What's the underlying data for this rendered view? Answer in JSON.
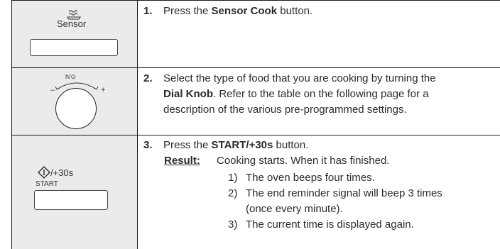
{
  "steps": [
    {
      "number": "1.",
      "text_before": "Press the ",
      "bold": "Sensor Cook",
      "text_after": " button.",
      "panel": {
        "label": "Sensor",
        "icon": "sensor-steam-icon"
      }
    },
    {
      "number": "2.",
      "line1": "Select the type of food that you are cooking by turning the",
      "bold": "Dial Knob",
      "line2_after": ". Refer to the table on the following page for a",
      "line3": "description of the various pre-programmed settings.",
      "panel": {
        "dial_top_label": "h/⊙",
        "minus": "–",
        "plus": "+",
        "icon": "dial-knob-icon"
      }
    },
    {
      "number": "3.",
      "text_before": "Press the ",
      "bold": "START/+30s",
      "text_after": " button.",
      "result_label": "Result:",
      "result_text": "Cooking starts. When it has finished.",
      "sub_items": [
        {
          "num": "1)",
          "lines": [
            "The oven beeps four times."
          ]
        },
        {
          "num": "2)",
          "lines": [
            "The end reminder signal will beep 3 times",
            "(once every minute)."
          ]
        },
        {
          "num": "3)",
          "lines": [
            "The current time is displayed again."
          ]
        }
      ],
      "panel": {
        "label_top": "/+30s",
        "label_bottom": "START",
        "icon": "start-icon"
      }
    }
  ]
}
